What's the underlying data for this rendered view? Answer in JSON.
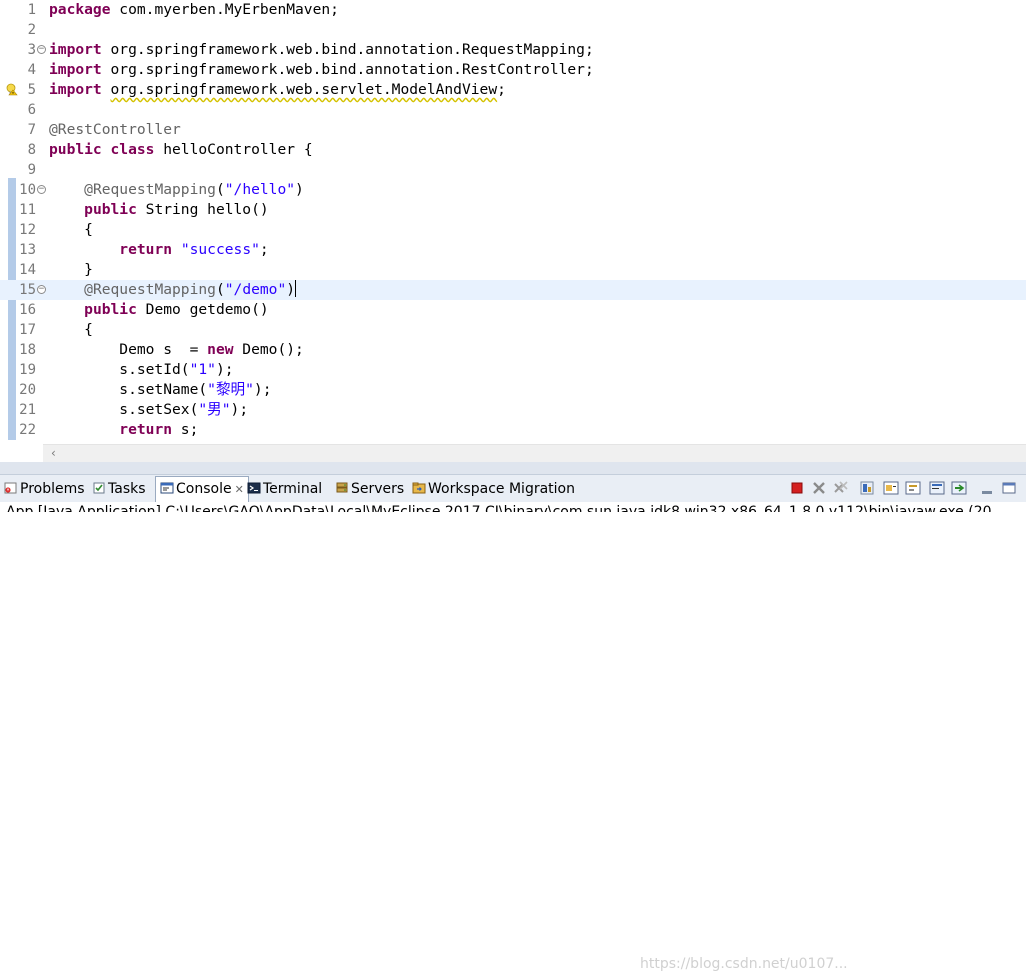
{
  "editor": {
    "lines": [
      {
        "n": "1",
        "tokens": [
          {
            "t": "kw",
            "v": "package"
          },
          {
            "t": "plain",
            "v": " com.myerben.MyErbenMaven;"
          }
        ]
      },
      {
        "n": "2",
        "tokens": []
      },
      {
        "n": "3",
        "fold": true,
        "tokens": [
          {
            "t": "kw",
            "v": "import"
          },
          {
            "t": "plain",
            "v": " org.springframework.web.bind.annotation.RequestMapping;"
          }
        ]
      },
      {
        "n": "4",
        "tokens": [
          {
            "t": "kw",
            "v": "import"
          },
          {
            "t": "plain",
            "v": " org.springframework.web.bind.annotation.RestController;"
          }
        ]
      },
      {
        "n": "5",
        "warning": true,
        "tokens": [
          {
            "t": "kw",
            "v": "import"
          },
          {
            "t": "plain",
            "v": " "
          },
          {
            "t": "warn",
            "v": "org.springframework.web.servlet.ModelAndView"
          },
          {
            "t": "plain",
            "v": ";"
          }
        ]
      },
      {
        "n": "6",
        "tokens": []
      },
      {
        "n": "7",
        "tokens": [
          {
            "t": "ann",
            "v": "@RestController"
          }
        ]
      },
      {
        "n": "8",
        "tokens": [
          {
            "t": "kw",
            "v": "public"
          },
          {
            "t": "plain",
            "v": " "
          },
          {
            "t": "kw",
            "v": "class"
          },
          {
            "t": "plain",
            "v": " helloController {"
          }
        ]
      },
      {
        "n": "9",
        "tokens": []
      },
      {
        "n": "10",
        "fold": true,
        "tokens": [
          {
            "t": "plain",
            "v": "    "
          },
          {
            "t": "ann",
            "v": "@RequestMapping"
          },
          {
            "t": "plain",
            "v": "("
          },
          {
            "t": "str",
            "v": "\"/hello\""
          },
          {
            "t": "plain",
            "v": ")"
          }
        ]
      },
      {
        "n": "11",
        "tokens": [
          {
            "t": "plain",
            "v": "    "
          },
          {
            "t": "kw",
            "v": "public"
          },
          {
            "t": "plain",
            "v": " String hello()"
          }
        ]
      },
      {
        "n": "12",
        "tokens": [
          {
            "t": "plain",
            "v": "    {"
          }
        ]
      },
      {
        "n": "13",
        "tokens": [
          {
            "t": "plain",
            "v": "        "
          },
          {
            "t": "kw",
            "v": "return"
          },
          {
            "t": "plain",
            "v": " "
          },
          {
            "t": "str",
            "v": "\"success\""
          },
          {
            "t": "plain",
            "v": ";"
          }
        ]
      },
      {
        "n": "14",
        "tokens": [
          {
            "t": "plain",
            "v": "    }"
          }
        ]
      },
      {
        "n": "15",
        "fold": true,
        "current": true,
        "caret": true,
        "tokens": [
          {
            "t": "plain",
            "v": "    "
          },
          {
            "t": "ann",
            "v": "@RequestMapping"
          },
          {
            "t": "plain",
            "v": "("
          },
          {
            "t": "str",
            "v": "\"/demo\""
          },
          {
            "t": "plain",
            "v": ")"
          }
        ]
      },
      {
        "n": "16",
        "tokens": [
          {
            "t": "plain",
            "v": "    "
          },
          {
            "t": "kw",
            "v": "public"
          },
          {
            "t": "plain",
            "v": " Demo getdemo()"
          }
        ]
      },
      {
        "n": "17",
        "tokens": [
          {
            "t": "plain",
            "v": "    {"
          }
        ]
      },
      {
        "n": "18",
        "tokens": [
          {
            "t": "plain",
            "v": "        Demo s  = "
          },
          {
            "t": "kw",
            "v": "new"
          },
          {
            "t": "plain",
            "v": " Demo();"
          }
        ]
      },
      {
        "n": "19",
        "tokens": [
          {
            "t": "plain",
            "v": "        s.setId("
          },
          {
            "t": "str",
            "v": "\"1\""
          },
          {
            "t": "plain",
            "v": ");"
          }
        ]
      },
      {
        "n": "20",
        "tokens": [
          {
            "t": "plain",
            "v": "        s.setName("
          },
          {
            "t": "str",
            "v": "\"黎明\""
          },
          {
            "t": "plain",
            "v": ");"
          }
        ]
      },
      {
        "n": "21",
        "tokens": [
          {
            "t": "plain",
            "v": "        s.setSex("
          },
          {
            "t": "str",
            "v": "\"男\""
          },
          {
            "t": "plain",
            "v": ");"
          }
        ]
      },
      {
        "n": "22",
        "tokens": [
          {
            "t": "plain",
            "v": "        "
          },
          {
            "t": "kw",
            "v": "return"
          },
          {
            "t": "plain",
            "v": " s;"
          }
        ]
      }
    ],
    "colors": {
      "keyword": "#7f0055",
      "annotation": "#646464",
      "string": "#2a00ff",
      "current_line": "#e8f2fe"
    }
  },
  "icons": {
    "scroll_left": "scroll-left-arrow-icon",
    "warning": "warning-lightbulb-icon"
  },
  "tabs": [
    {
      "name": "tab-problems",
      "label": "Problems",
      "icon": "problems-icon"
    },
    {
      "name": "tab-tasks",
      "label": "Tasks",
      "icon": "tasks-icon"
    },
    {
      "name": "tab-console",
      "label": "Console",
      "icon": "console-icon",
      "active": true,
      "close": "✕"
    },
    {
      "name": "tab-terminal",
      "label": "Terminal",
      "icon": "terminal-icon"
    },
    {
      "name": "tab-servers",
      "label": "Servers",
      "icon": "servers-icon"
    },
    {
      "name": "tab-workspace-migration",
      "label": "Workspace Migration",
      "icon": "workspace-migration-icon"
    }
  ],
  "toolbar": [
    "terminate-icon",
    "remove-launch-icon",
    "remove-all-icon",
    "scroll-lock-icon",
    "show-console-icon",
    "pin-console-icon",
    "display-console-icon",
    "open-console-icon",
    "minimize-icon",
    "maximize-icon"
  ],
  "watermark": "https://blog.csdn.net/u0107...",
  "console": {
    "text": "App [Java Application] C:\\Users\\GAO\\AppData\\Local\\MyEclipse 2017 CI\\binary\\com.sun.java.jdk8.win32.x86_64_1.8.0.v112\\bin\\javaw.exe (20"
  }
}
